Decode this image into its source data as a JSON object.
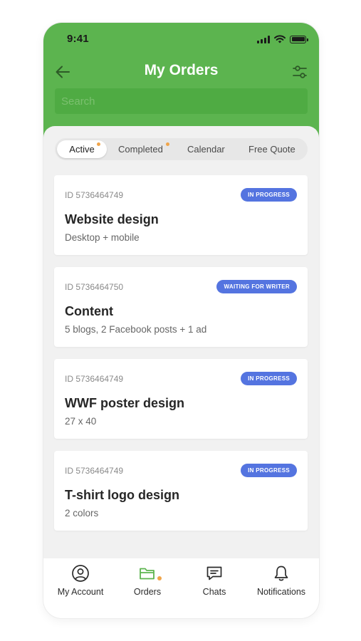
{
  "status_bar": {
    "time": "9:41"
  },
  "header": {
    "title": "My Orders",
    "back_icon": "arrow-left-icon",
    "filter_icon": "sliders-icon",
    "background": "#5cb44f"
  },
  "search": {
    "placeholder": "Search",
    "value": ""
  },
  "tabs": [
    {
      "label": "Active",
      "active": true,
      "has_dot": true
    },
    {
      "label": "Completed",
      "active": false,
      "has_dot": true
    },
    {
      "label": "Calendar",
      "active": false,
      "has_dot": false
    },
    {
      "label": "Free Quote",
      "active": false,
      "has_dot": false
    }
  ],
  "orders": [
    {
      "id": "ID 5736464749",
      "status": "IN PROGRESS",
      "title": "Website design",
      "description": "Desktop + mobile"
    },
    {
      "id": "ID 5736464750",
      "status": "WAITING FOR WRITER",
      "title": "Content",
      "description": "5 blogs, 2 Facebook posts + 1 ad"
    },
    {
      "id": "ID 5736464749",
      "status": "IN PROGRESS",
      "title": "WWF poster design",
      "description": "27 x 40"
    },
    {
      "id": "ID 5736464749",
      "status": "IN PROGRESS",
      "title": "T-shirt logo design",
      "description": "2 colors"
    }
  ],
  "bottom_nav": [
    {
      "label": "My Account",
      "icon": "user-circle-icon",
      "active": false
    },
    {
      "label": "Orders",
      "icon": "folder-icon",
      "active": true,
      "has_dot": true
    },
    {
      "label": "Chats",
      "icon": "chat-bubble-icon",
      "active": false
    },
    {
      "label": "Notifications",
      "icon": "bell-icon",
      "active": false
    }
  ],
  "colors": {
    "primary_green": "#5cb44f",
    "badge_blue": "#5474e0",
    "dot_orange": "#f0a54b"
  }
}
